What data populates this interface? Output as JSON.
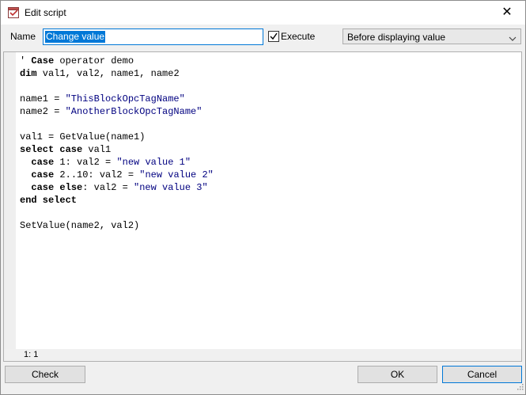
{
  "window": {
    "title": "Edit script",
    "close_glyph": "✕"
  },
  "form": {
    "name_label": "Name",
    "name_value": "Change value",
    "execute_label": "Execute",
    "execute_checked": true,
    "trigger_value": "Before displaying value"
  },
  "editor": {
    "lines": [
      [
        {
          "t": "' ",
          "c": "cmt"
        },
        {
          "t": "Case",
          "c": "kw"
        },
        {
          "t": " operator demo",
          "c": "cmt"
        }
      ],
      [
        {
          "t": "dim",
          "c": "kw"
        },
        {
          "t": " val1, val2, name1, name2",
          "c": ""
        }
      ],
      [],
      [
        {
          "t": "name1 = ",
          "c": ""
        },
        {
          "t": "\"ThisBlockOpcTagName\"",
          "c": "str"
        }
      ],
      [
        {
          "t": "name2 = ",
          "c": ""
        },
        {
          "t": "\"AnotherBlockOpcTagName\"",
          "c": "str"
        }
      ],
      [],
      [
        {
          "t": "val1 = GetValue(name1)",
          "c": ""
        }
      ],
      [
        {
          "t": "select case",
          "c": "kw"
        },
        {
          "t": " val1",
          "c": ""
        }
      ],
      [
        {
          "t": "  ",
          "c": ""
        },
        {
          "t": "case",
          "c": "kw"
        },
        {
          "t": " 1: val2 = ",
          "c": ""
        },
        {
          "t": "\"new value 1\"",
          "c": "str"
        }
      ],
      [
        {
          "t": "  ",
          "c": ""
        },
        {
          "t": "case",
          "c": "kw"
        },
        {
          "t": " 2..10: val2 = ",
          "c": ""
        },
        {
          "t": "\"new value 2\"",
          "c": "str"
        }
      ],
      [
        {
          "t": "  ",
          "c": ""
        },
        {
          "t": "case else",
          "c": "kw"
        },
        {
          "t": ": val2 = ",
          "c": ""
        },
        {
          "t": "\"new value 3\"",
          "c": "str"
        }
      ],
      [
        {
          "t": "end select",
          "c": "kw"
        }
      ],
      [],
      [
        {
          "t": "SetValue(name2, val2)",
          "c": ""
        }
      ]
    ],
    "cursor_position": "1: 1"
  },
  "buttons": {
    "check": "Check",
    "ok": "OK",
    "cancel": "Cancel"
  },
  "colors": {
    "accent": "#0078d7",
    "string": "#000080"
  }
}
